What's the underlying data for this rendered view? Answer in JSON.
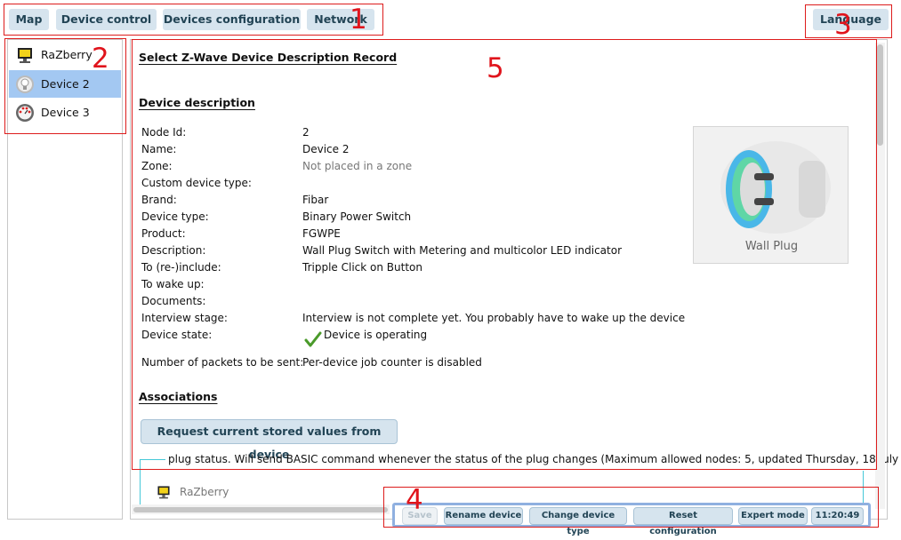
{
  "top_tabs": [
    {
      "label": "Map"
    },
    {
      "label": "Device control"
    },
    {
      "label": "Devices configuration"
    },
    {
      "label": "Network"
    }
  ],
  "language_button": "Language",
  "annotations": [
    "1",
    "2",
    "3",
    "4",
    "5"
  ],
  "devices": [
    {
      "label": "RaZberry",
      "icon": "controller-icon",
      "selected": false
    },
    {
      "label": "Device 2",
      "icon": "lightbulb-icon",
      "selected": true
    },
    {
      "label": "Device 3",
      "icon": "gauge-icon",
      "selected": false
    }
  ],
  "main": {
    "title": "Select Z-Wave Device Description Record",
    "section_description": "Device description",
    "rows": [
      {
        "label": "Node Id:",
        "value": "2"
      },
      {
        "label": "Name:",
        "value": "Device 2"
      },
      {
        "label": "Zone:",
        "value": "Not placed in a zone"
      },
      {
        "label": "Custom device type:",
        "value": ""
      },
      {
        "label": "Brand:",
        "value": "Fibar"
      },
      {
        "label": "Device type:",
        "value": "Binary Power Switch"
      },
      {
        "label": "Product:",
        "value": "FGWPE"
      },
      {
        "label": "Description:",
        "value": "Wall Plug Switch with Metering and multicolor LED indicator"
      },
      {
        "label": "To (re-)include:",
        "value": "Tripple Click on Button"
      },
      {
        "label": "To wake up:",
        "value": ""
      },
      {
        "label": "Documents:",
        "value": ""
      },
      {
        "label": "Interview stage:",
        "value": "Interview is not complete yet. You probably have to wake up the device"
      },
      {
        "label": "Device state:",
        "value": "Device is operating"
      }
    ],
    "packets_label": "Number of packets to be sent:",
    "packets_value": "Per-device job counter is disabled",
    "device_image_caption": "Wall Plug",
    "section_associations": "Associations",
    "request_button": "Request current stored values from device",
    "assoc_text": "plug status. Will send BASIC command whenever the status of the plug changes (Maximum allowed nodes: 5, updated Thursday, 18 July",
    "assoc_node": "RaZberry"
  },
  "bottom_buttons": [
    "Save",
    "Rename device",
    "Change device type",
    "Reset configuration",
    "Expert mode",
    "11:20:49"
  ],
  "colors": {
    "tab_bg": "#d6e4ee",
    "selected_bg": "#a3c8f2",
    "annotation_red": "#e0141c",
    "check_green": "#4a9a2a"
  }
}
